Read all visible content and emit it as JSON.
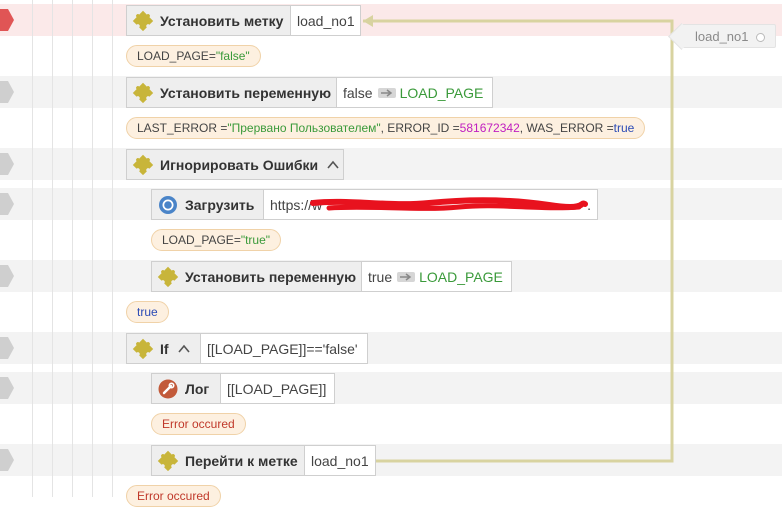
{
  "colors": {
    "string": "#3a9a3a",
    "number": "#c020c0",
    "keyword": "#2a4ab5",
    "error": "#c0392b",
    "connector": "#d8d3a0"
  },
  "label_tag": {
    "text": "load_no1"
  },
  "blocks": {
    "set_label": {
      "label": "Установить метку",
      "arg": "load_no1",
      "icon": "puzzle-icon"
    },
    "set_var_1": {
      "label": "Установить переменную",
      "value": "false",
      "target": "LOAD_PAGE",
      "icon": "puzzle-icon"
    },
    "ignore_errors": {
      "label": "Игнорировать Ошибки",
      "icon": "puzzle-icon"
    },
    "load": {
      "label": "Загрузить",
      "arg_prefix": "https://w",
      "arg_suffix": ".",
      "icon": "chrome-icon"
    },
    "set_var_2": {
      "label": "Установить переменную",
      "value": "true",
      "target": "LOAD_PAGE",
      "icon": "puzzle-icon"
    },
    "if": {
      "label": "If",
      "arg": "[[LOAD_PAGE]]=='false'",
      "icon": "puzzle-icon"
    },
    "log": {
      "label": "Лог",
      "arg": "[[LOAD_PAGE]]",
      "icon": "log-icon"
    },
    "goto": {
      "label": "Перейти к метке",
      "arg": "load_no1",
      "icon": "puzzle-icon"
    }
  },
  "results": {
    "r1": {
      "name": "LOAD_PAGE",
      "eq": " = ",
      "value": "\"false\""
    },
    "r2": {
      "p1": "LAST_ERROR = ",
      "v1": "\"Прервано Пользователем\"",
      "p2": ", ERROR_ID = ",
      "v2": "581672342",
      "p3": ", WAS_ERROR = ",
      "v3": "true"
    },
    "r3": {
      "name": "LOAD_PAGE",
      "eq": " = ",
      "value": "\"true\""
    },
    "r4": {
      "value": "true"
    },
    "r5": {
      "value": "Error occured"
    },
    "r6": {
      "value": "Error occured"
    }
  }
}
